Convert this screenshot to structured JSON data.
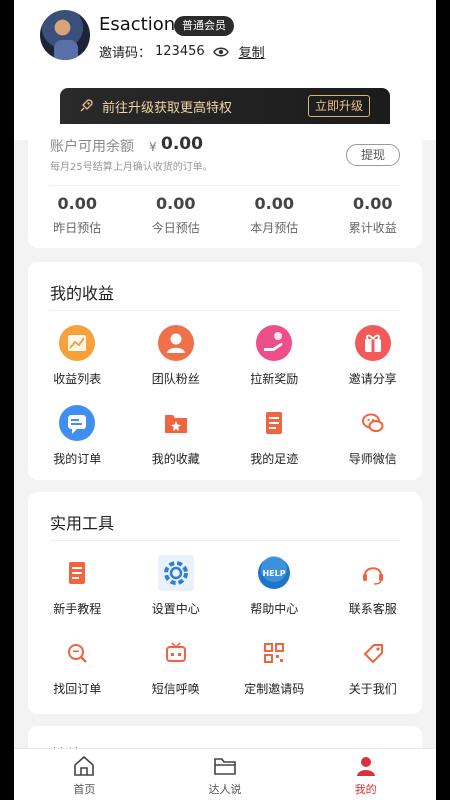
{
  "profile": {
    "username": "Esaction",
    "member_level": "普通会员",
    "invite_label": "邀请码：",
    "invite_code": "123456",
    "copy_label": "复制"
  },
  "upgrade": {
    "text": "前往升级获取更高特权",
    "button": "立即升级"
  },
  "balance": {
    "title": "账户可用余额",
    "currency": "¥",
    "amount": "0.00",
    "note": "每月25号结算上月确认收货的订单。",
    "withdraw_label": "提现",
    "stats": [
      {
        "value": "0.00",
        "label": "昨日预估"
      },
      {
        "value": "0.00",
        "label": "今日预估"
      },
      {
        "value": "0.00",
        "label": "本月预估"
      },
      {
        "value": "0.00",
        "label": "累计收益"
      }
    ]
  },
  "earnings": {
    "title": "我的收益",
    "items": [
      {
        "label": "收益列表",
        "icon": "chart-icon"
      },
      {
        "label": "团队粉丝",
        "icon": "person-icon"
      },
      {
        "label": "拉新奖励",
        "icon": "hand-icon"
      },
      {
        "label": "邀请分享",
        "icon": "gift-icon"
      },
      {
        "label": "我的订单",
        "icon": "chat-icon"
      },
      {
        "label": "我的收藏",
        "icon": "folder-star-icon"
      },
      {
        "label": "我的足迹",
        "icon": "document-icon"
      },
      {
        "label": "导师微信",
        "icon": "wechat-icon"
      }
    ]
  },
  "tools": {
    "title": "实用工具",
    "items": [
      {
        "label": "新手教程",
        "icon": "document-icon"
      },
      {
        "label": "设置中心",
        "icon": "gear-icon"
      },
      {
        "label": "帮助中心",
        "icon": "help-icon"
      },
      {
        "label": "联系客服",
        "icon": "headset-icon"
      },
      {
        "label": "找回订单",
        "icon": "search-doc-icon"
      },
      {
        "label": "短信呼唤",
        "icon": "tv-icon"
      },
      {
        "label": "定制邀请码",
        "icon": "qr-icon"
      },
      {
        "label": "关于我们",
        "icon": "tag-icon"
      }
    ]
  },
  "other": {
    "title": "其他"
  },
  "nav": {
    "items": [
      {
        "label": "首页",
        "icon": "home-icon"
      },
      {
        "label": "达人说",
        "icon": "folder-icon"
      },
      {
        "label": "我的",
        "icon": "user-icon"
      }
    ],
    "active_color": "#d9303d"
  },
  "colors": {
    "accent": "#d9303d",
    "gold": "#e8c28d"
  }
}
